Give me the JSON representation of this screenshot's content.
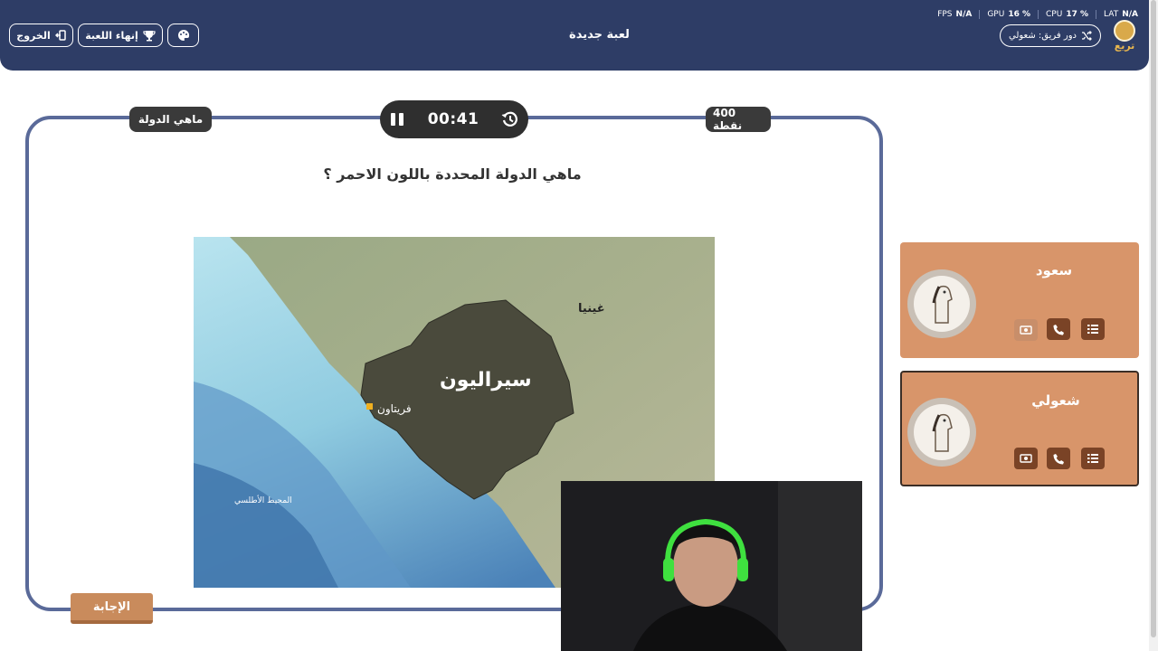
{
  "header": {
    "exit_label": "الخروج",
    "end_game_label": "إنهاء اللعبة",
    "title": "لعبة جديدة",
    "team_turn_label": "دور فريق: شعولي",
    "logo_text": "تريع",
    "stats": [
      {
        "label": "FPS",
        "value": "N/A"
      },
      {
        "label": "GPU",
        "value": "16 %"
      },
      {
        "label": "CPU",
        "value": "17 %"
      },
      {
        "label": "LAT",
        "value": "N/A"
      }
    ]
  },
  "game": {
    "category_label": "ماهي الدولة",
    "points_label": "400 نقطة",
    "timer": "00:41",
    "question": "ماهي الدولة المحددة باللون الاحمر ؟",
    "answer_button": "الإجابة",
    "map_labels": {
      "country": "سيراليون",
      "neighbor": "غينيا",
      "capital": "فريتاون",
      "ocean": "المحيط الأطلسي"
    }
  },
  "teams": [
    {
      "name": "سعود"
    },
    {
      "name": "شعولي"
    }
  ],
  "colors": {
    "header_bg": "#2e3d66",
    "frame_border": "#5a6a99",
    "team_card": "#d8956a",
    "tool_button": "#7a4326",
    "answer_button": "#c98b5c"
  }
}
